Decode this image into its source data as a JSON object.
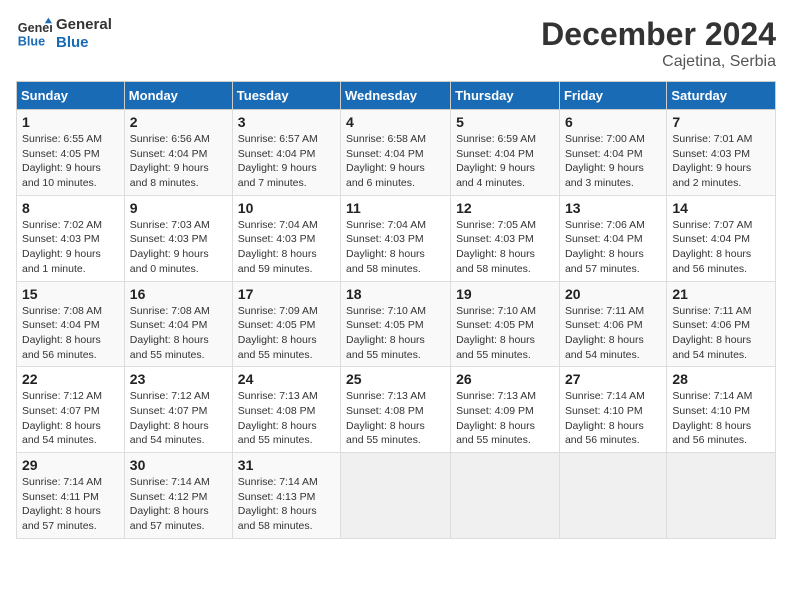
{
  "header": {
    "logo_line1": "General",
    "logo_line2": "Blue",
    "month_title": "December 2024",
    "location": "Cajetina, Serbia"
  },
  "weekdays": [
    "Sunday",
    "Monday",
    "Tuesday",
    "Wednesday",
    "Thursday",
    "Friday",
    "Saturday"
  ],
  "weeks": [
    [
      {
        "day": "1",
        "detail": "Sunrise: 6:55 AM\nSunset: 4:05 PM\nDaylight: 9 hours\nand 10 minutes."
      },
      {
        "day": "2",
        "detail": "Sunrise: 6:56 AM\nSunset: 4:04 PM\nDaylight: 9 hours\nand 8 minutes."
      },
      {
        "day": "3",
        "detail": "Sunrise: 6:57 AM\nSunset: 4:04 PM\nDaylight: 9 hours\nand 7 minutes."
      },
      {
        "day": "4",
        "detail": "Sunrise: 6:58 AM\nSunset: 4:04 PM\nDaylight: 9 hours\nand 6 minutes."
      },
      {
        "day": "5",
        "detail": "Sunrise: 6:59 AM\nSunset: 4:04 PM\nDaylight: 9 hours\nand 4 minutes."
      },
      {
        "day": "6",
        "detail": "Sunrise: 7:00 AM\nSunset: 4:04 PM\nDaylight: 9 hours\nand 3 minutes."
      },
      {
        "day": "7",
        "detail": "Sunrise: 7:01 AM\nSunset: 4:03 PM\nDaylight: 9 hours\nand 2 minutes."
      }
    ],
    [
      {
        "day": "8",
        "detail": "Sunrise: 7:02 AM\nSunset: 4:03 PM\nDaylight: 9 hours\nand 1 minute."
      },
      {
        "day": "9",
        "detail": "Sunrise: 7:03 AM\nSunset: 4:03 PM\nDaylight: 9 hours\nand 0 minutes."
      },
      {
        "day": "10",
        "detail": "Sunrise: 7:04 AM\nSunset: 4:03 PM\nDaylight: 8 hours\nand 59 minutes."
      },
      {
        "day": "11",
        "detail": "Sunrise: 7:04 AM\nSunset: 4:03 PM\nDaylight: 8 hours\nand 58 minutes."
      },
      {
        "day": "12",
        "detail": "Sunrise: 7:05 AM\nSunset: 4:03 PM\nDaylight: 8 hours\nand 58 minutes."
      },
      {
        "day": "13",
        "detail": "Sunrise: 7:06 AM\nSunset: 4:04 PM\nDaylight: 8 hours\nand 57 minutes."
      },
      {
        "day": "14",
        "detail": "Sunrise: 7:07 AM\nSunset: 4:04 PM\nDaylight: 8 hours\nand 56 minutes."
      }
    ],
    [
      {
        "day": "15",
        "detail": "Sunrise: 7:08 AM\nSunset: 4:04 PM\nDaylight: 8 hours\nand 56 minutes."
      },
      {
        "day": "16",
        "detail": "Sunrise: 7:08 AM\nSunset: 4:04 PM\nDaylight: 8 hours\nand 55 minutes."
      },
      {
        "day": "17",
        "detail": "Sunrise: 7:09 AM\nSunset: 4:05 PM\nDaylight: 8 hours\nand 55 minutes."
      },
      {
        "day": "18",
        "detail": "Sunrise: 7:10 AM\nSunset: 4:05 PM\nDaylight: 8 hours\nand 55 minutes."
      },
      {
        "day": "19",
        "detail": "Sunrise: 7:10 AM\nSunset: 4:05 PM\nDaylight: 8 hours\nand 55 minutes."
      },
      {
        "day": "20",
        "detail": "Sunrise: 7:11 AM\nSunset: 4:06 PM\nDaylight: 8 hours\nand 54 minutes."
      },
      {
        "day": "21",
        "detail": "Sunrise: 7:11 AM\nSunset: 4:06 PM\nDaylight: 8 hours\nand 54 minutes."
      }
    ],
    [
      {
        "day": "22",
        "detail": "Sunrise: 7:12 AM\nSunset: 4:07 PM\nDaylight: 8 hours\nand 54 minutes."
      },
      {
        "day": "23",
        "detail": "Sunrise: 7:12 AM\nSunset: 4:07 PM\nDaylight: 8 hours\nand 54 minutes."
      },
      {
        "day": "24",
        "detail": "Sunrise: 7:13 AM\nSunset: 4:08 PM\nDaylight: 8 hours\nand 55 minutes."
      },
      {
        "day": "25",
        "detail": "Sunrise: 7:13 AM\nSunset: 4:08 PM\nDaylight: 8 hours\nand 55 minutes."
      },
      {
        "day": "26",
        "detail": "Sunrise: 7:13 AM\nSunset: 4:09 PM\nDaylight: 8 hours\nand 55 minutes."
      },
      {
        "day": "27",
        "detail": "Sunrise: 7:14 AM\nSunset: 4:10 PM\nDaylight: 8 hours\nand 56 minutes."
      },
      {
        "day": "28",
        "detail": "Sunrise: 7:14 AM\nSunset: 4:10 PM\nDaylight: 8 hours\nand 56 minutes."
      }
    ],
    [
      {
        "day": "29",
        "detail": "Sunrise: 7:14 AM\nSunset: 4:11 PM\nDaylight: 8 hours\nand 57 minutes."
      },
      {
        "day": "30",
        "detail": "Sunrise: 7:14 AM\nSunset: 4:12 PM\nDaylight: 8 hours\nand 57 minutes."
      },
      {
        "day": "31",
        "detail": "Sunrise: 7:14 AM\nSunset: 4:13 PM\nDaylight: 8 hours\nand 58 minutes."
      },
      {
        "day": "",
        "detail": ""
      },
      {
        "day": "",
        "detail": ""
      },
      {
        "day": "",
        "detail": ""
      },
      {
        "day": "",
        "detail": ""
      }
    ]
  ]
}
